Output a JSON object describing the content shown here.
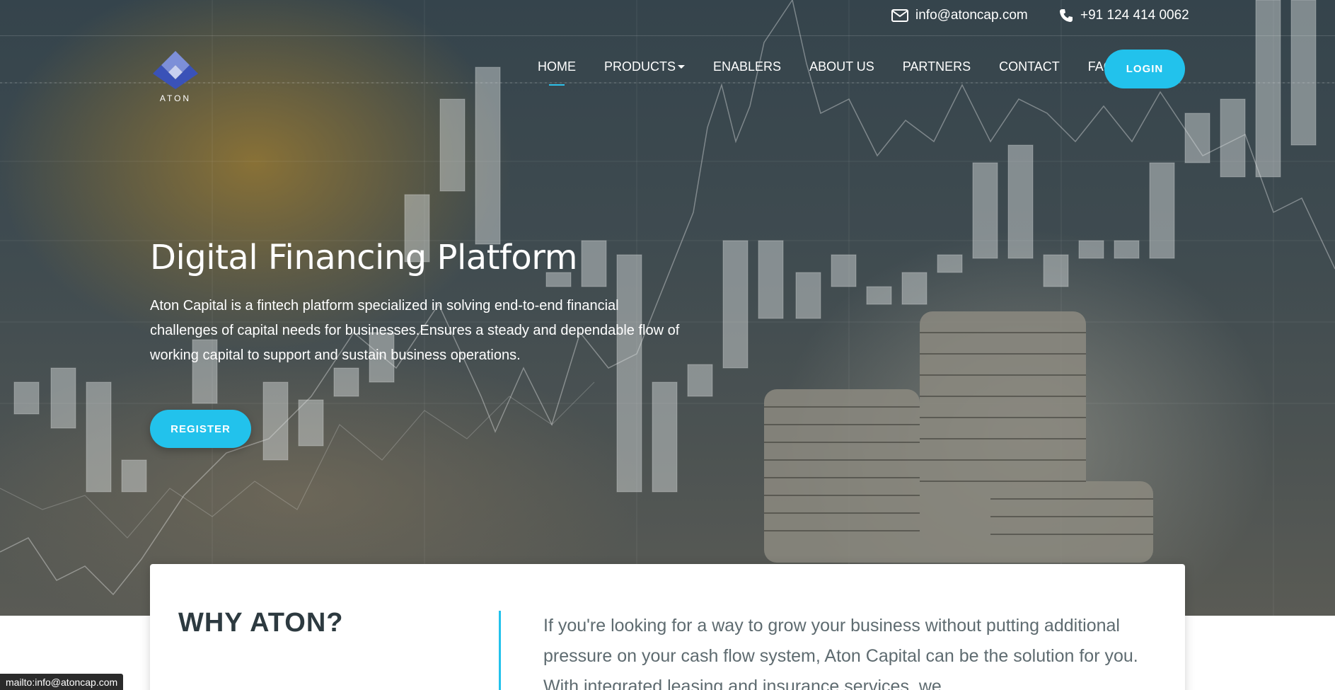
{
  "topbar": {
    "email": "info@atoncap.com",
    "phone": "+91 124 414 0062"
  },
  "logo": {
    "text": "ATON"
  },
  "nav": {
    "items": [
      {
        "label": "HOME",
        "active": true
      },
      {
        "label": "PRODUCTS",
        "has_dropdown": true
      },
      {
        "label": "ENABLERS"
      },
      {
        "label": "ABOUT US"
      },
      {
        "label": "PARTNERS"
      },
      {
        "label": "CONTACT"
      },
      {
        "label": "FAQ"
      }
    ],
    "login_label": "LOGIN"
  },
  "hero": {
    "title": "Digital Financing Platform",
    "description": "Aton Capital is a fintech platform specialized in solving end-to-end financial challenges of capital needs for businesses.Ensures a steady and dependable flow of working capital to support and sustain business operations.",
    "register_label": "REGISTER"
  },
  "why": {
    "title": "WHY ATON?",
    "text": "If you're looking for a way to grow your business without putting additional pressure on your cash flow system, Aton Capital can be the solution for you. With integrated leasing and insurance services, we"
  },
  "status_bar": {
    "text": "mailto:info@atoncap.com"
  },
  "colors": {
    "accent": "#22c2ec",
    "heading_dark": "#2d3a40",
    "body_grey": "#5e6b70"
  },
  "icons": {
    "email": "envelope-icon",
    "phone": "phone-icon",
    "logo": "aton-diamond-logo"
  }
}
